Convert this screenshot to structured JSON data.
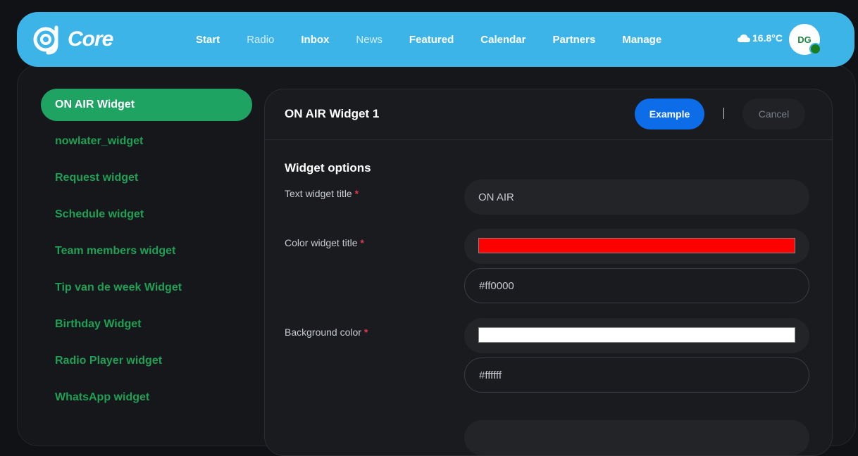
{
  "app": {
    "logo_text": "Core"
  },
  "nav": {
    "items": [
      {
        "label": "Start"
      },
      {
        "label": "Radio"
      },
      {
        "label": "Inbox"
      },
      {
        "label": "News"
      },
      {
        "label": "Featured"
      },
      {
        "label": "Calendar"
      },
      {
        "label": "Partners"
      },
      {
        "label": "Manage"
      }
    ]
  },
  "weather": {
    "temperature": "16.8°C",
    "icon": "cloud-icon"
  },
  "user": {
    "initials": "DG",
    "status": "online"
  },
  "sidebar": {
    "items": [
      {
        "label": "ON AIR Widget",
        "active": true
      },
      {
        "label": "nowlater_widget"
      },
      {
        "label": "Request widget"
      },
      {
        "label": "Schedule widget"
      },
      {
        "label": "Team members widget"
      },
      {
        "label": "Tip van de week Widget"
      },
      {
        "label": "Birthday Widget"
      },
      {
        "label": "Radio Player widget"
      },
      {
        "label": "WhatsApp widget"
      }
    ]
  },
  "card": {
    "title": "ON AIR Widget 1",
    "example_label": "Example",
    "cancel_label": "Cancel"
  },
  "form": {
    "section_title": "Widget options",
    "required_mark": "*",
    "text_title": {
      "label": "Text widget title",
      "value": "ON AIR"
    },
    "color_title": {
      "label": "Color widget title",
      "value": "#ff0000"
    },
    "background_color": {
      "label": "Background color",
      "value": "#ffffff"
    }
  },
  "colors": {
    "topbar": "#3db4e8",
    "accent_green": "#1ea363",
    "primary_blue": "#0d6ce7",
    "background": "#111215"
  }
}
